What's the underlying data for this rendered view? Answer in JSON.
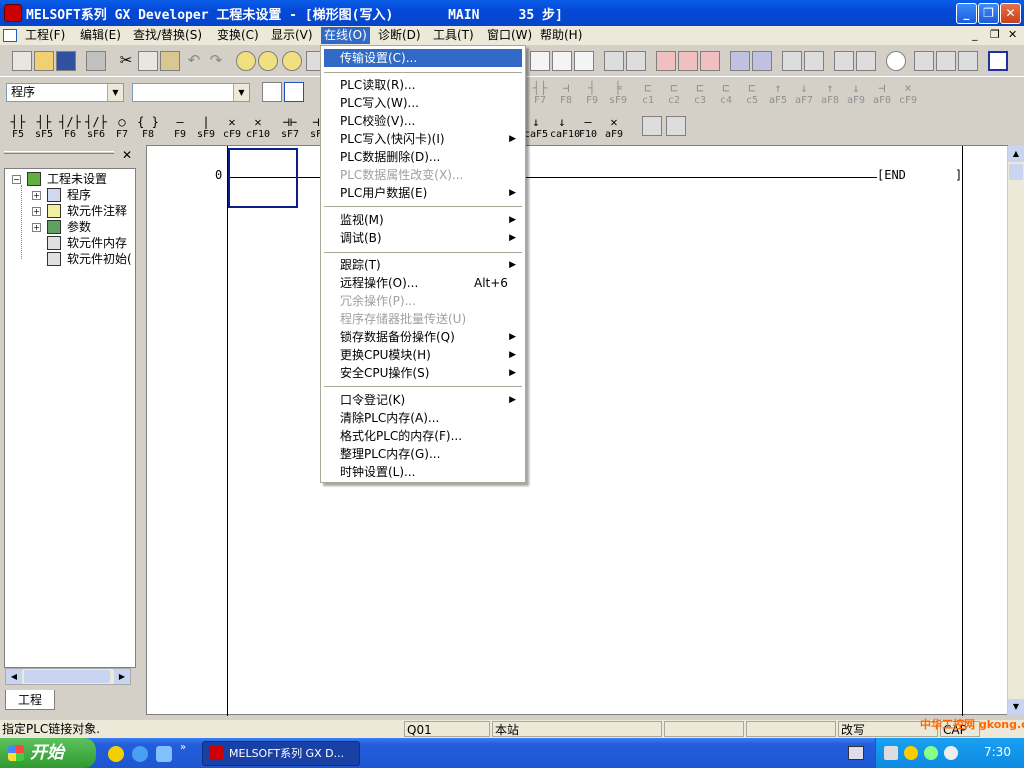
{
  "title": {
    "text": "MELSOFT系列 GX Developer 工程未设置 - [梯形图(写入)       MAIN     35 步]",
    "min_icon": "minimize-icon",
    "max_icon": "restore-icon",
    "close_icon": "close-icon"
  },
  "menubar": {
    "items": [
      "工程(F)",
      "编辑(E)",
      "查找/替换(S)",
      "变换(C)",
      "显示(V)",
      "在线(O)",
      "诊断(D)",
      "工具(T)",
      "窗口(W)",
      "帮助(H)"
    ],
    "active_index": 5
  },
  "toolbar": {
    "combo1_value": "程序",
    "combo2_value": ""
  },
  "fkeys_row1": [
    "F7",
    "F8",
    "F9",
    "sF9",
    "c1",
    "c2",
    "c3",
    "c4",
    "c5",
    "aF5",
    "aF7",
    "aF8",
    "aF9",
    "aF0",
    "cF9"
  ],
  "fkeys_row2a": [
    "F5",
    "sF5",
    "F6",
    "sF6",
    "F7",
    "F8",
    "F9",
    "sF9",
    "cF9",
    "cF10",
    "sF7",
    "sF"
  ],
  "fkeys_row2b": [
    "caF5",
    "caF10",
    "F10",
    "aF9"
  ],
  "tree": {
    "root": "工程未设置",
    "children": [
      "程序",
      "软元件注释",
      "参数",
      "软元件内存",
      "软元件初始("
    ],
    "tab_label": "工程"
  },
  "ladder": {
    "step_number": "0",
    "end_label": "END"
  },
  "dropdown": {
    "groups": [
      [
        {
          "label": "传输设置(C)...",
          "selected": true
        }
      ],
      [
        {
          "label": "PLC读取(R)..."
        },
        {
          "label": "PLC写入(W)..."
        },
        {
          "label": "PLC校验(V)..."
        },
        {
          "label": "PLC写入(快闪卡)(I)",
          "submenu": true
        },
        {
          "label": "PLC数据删除(D)..."
        },
        {
          "label": "PLC数据属性改变(X)...",
          "disabled": true
        },
        {
          "label": "PLC用户数据(E)",
          "submenu": true
        }
      ],
      [
        {
          "label": "监视(M)",
          "submenu": true
        },
        {
          "label": "调试(B)",
          "submenu": true
        }
      ],
      [
        {
          "label": "跟踪(T)",
          "submenu": true
        },
        {
          "label": "远程操作(O)...",
          "shortcut": "Alt+6"
        },
        {
          "label": "冗余操作(P)...",
          "disabled": true
        },
        {
          "label": "程序存储器批量传送(U)",
          "disabled": true
        },
        {
          "label": "锁存数据备份操作(Q)",
          "submenu": true
        },
        {
          "label": "更换CPU模块(H)",
          "submenu": true
        },
        {
          "label": "安全CPU操作(S)",
          "submenu": true
        }
      ],
      [
        {
          "label": "口令登记(K)",
          "submenu": true
        },
        {
          "label": "清除PLC内存(A)..."
        },
        {
          "label": "格式化PLC的内存(F)..."
        },
        {
          "label": "整理PLC内存(G)..."
        },
        {
          "label": "时钟设置(L)..."
        }
      ]
    ]
  },
  "statusbar": {
    "message": "指定PLC链接对象.",
    "cpu": "Q01",
    "station": "本站",
    "mode": "改写",
    "caps": "CAP"
  },
  "taskbar": {
    "start_label": "开始",
    "task_label": "MELSOFT系列 GX D...",
    "clock": "7:30",
    "watermark": "中华工控网 gkong.com"
  },
  "colors": {
    "title_blue": "#0548d8",
    "menu_highlight": "#316ac5",
    "taskbar_blue": "#245edb",
    "start_green": "#2f9a2f",
    "cursor_border": "#0a1e8c"
  }
}
